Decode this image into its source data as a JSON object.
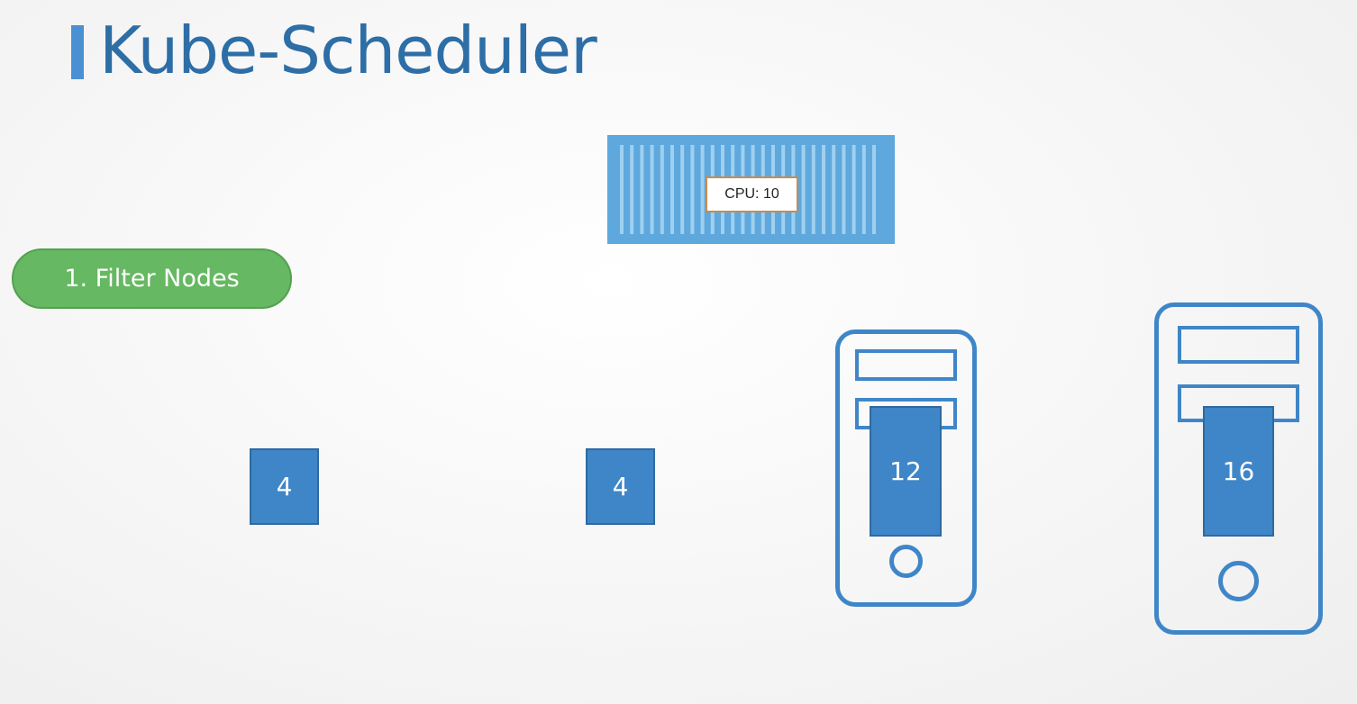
{
  "slide": {
    "title": "Kube-Scheduler",
    "title_color": "#2e6ea6",
    "accent_color": "#4a90d2"
  },
  "step": {
    "label": "1. Filter Nodes",
    "color": "#66b862"
  },
  "pod": {
    "icon": "container-icon",
    "color": "#5ea8dd",
    "cpu_label": "CPU: 10"
  },
  "nodes": [
    {
      "icon": "cpu-block",
      "cpu": "4"
    },
    {
      "icon": "cpu-block",
      "cpu": "4"
    },
    {
      "icon": "server-tower-icon",
      "cpu": "12"
    },
    {
      "icon": "server-tower-icon",
      "cpu": "16"
    }
  ],
  "node_color": "#3f86c8"
}
